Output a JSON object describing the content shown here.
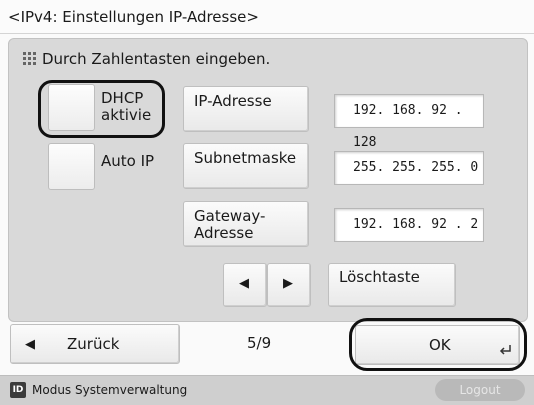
{
  "title": "<IPv4: Einstellungen IP-Adresse>",
  "instruction": "Durch Zahlentasten eingeben.",
  "toggles": [
    {
      "label_line1": "DHCP",
      "label_line2": "aktivie",
      "icon": "checkbox-unchecked"
    },
    {
      "label": "Auto IP",
      "icon": "checkbox-unchecked"
    }
  ],
  "fields": {
    "ip_label": "IP-Adresse",
    "ip_value": "192. 168. 92 . 128",
    "subnet_label": "Subnetmaske",
    "subnet_value": "255. 255. 255. 0",
    "gateway_label_line1": "Gateway-",
    "gateway_label_line2": "Adresse",
    "gateway_value": "192. 168. 92 . 2"
  },
  "buttons": {
    "clear": "Löschtaste",
    "back": "Zurück",
    "ok": "OK",
    "page": "5/9"
  },
  "status": {
    "text": "Modus Systemverwaltung",
    "icon_text": "ID",
    "logout": "Logout"
  },
  "icons": [
    "keypad-icon",
    "arrow-left-icon",
    "arrow-right-icon",
    "back-arrow-icon",
    "enter-icon"
  ]
}
